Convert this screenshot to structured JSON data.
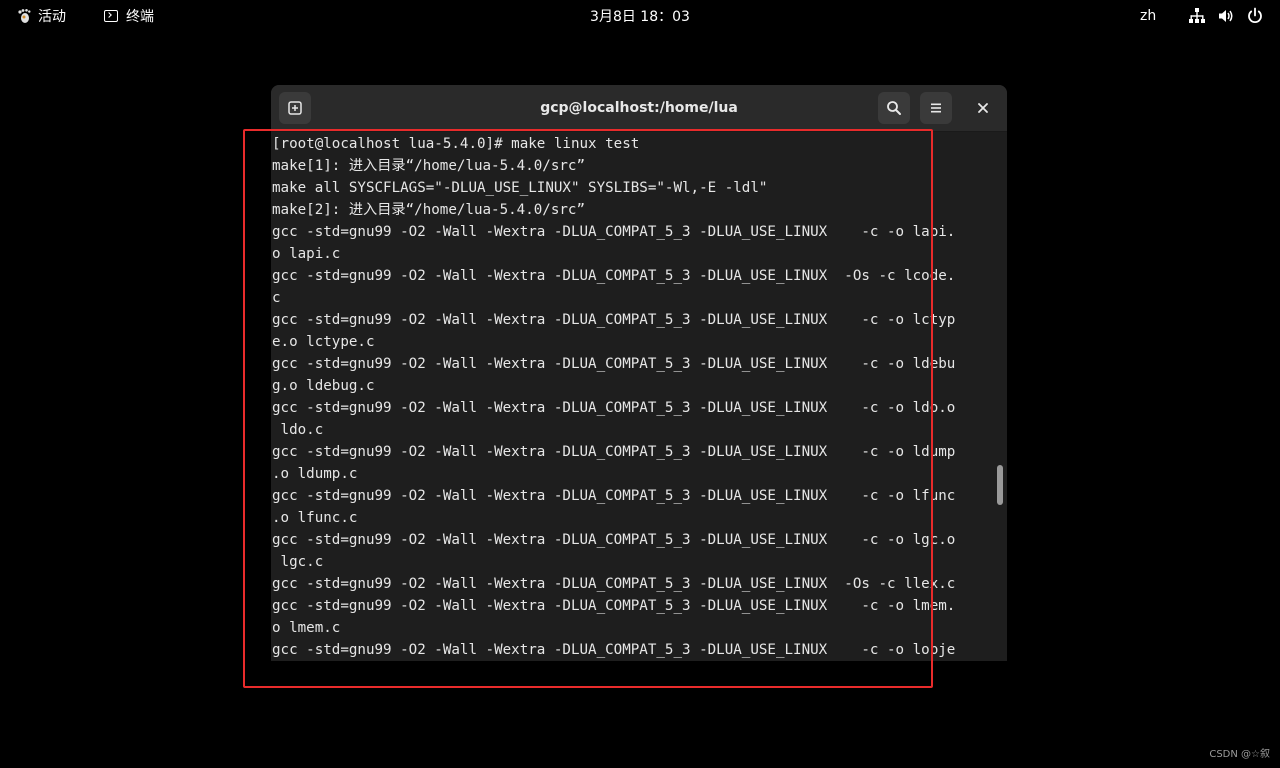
{
  "topbar": {
    "activities_label": "活动",
    "app_label": "终端",
    "clock": "3月8日 18：03",
    "language": "zh"
  },
  "icons": {
    "activities": "gnome-foot-icon",
    "app": "terminal-icon",
    "network": "network-icon",
    "volume": "volume-icon",
    "power": "power-icon",
    "new_tab": "new-tab-icon",
    "search": "search-icon",
    "menu": "hamburger-menu-icon",
    "close": "close-icon"
  },
  "window": {
    "title": "gcp@localhost:/home/lua"
  },
  "terminal": {
    "lines": [
      "[root@localhost lua-5.4.0]# make linux test",
      "make[1]: 进入目录“/home/lua-5.4.0/src”",
      "make all SYSCFLAGS=\"-DLUA_USE_LINUX\" SYSLIBS=\"-Wl,-E -ldl\"",
      "make[2]: 进入目录“/home/lua-5.4.0/src”",
      "gcc -std=gnu99 -O2 -Wall -Wextra -DLUA_COMPAT_5_3 -DLUA_USE_LINUX    -c -o lapi.",
      "o lapi.c",
      "gcc -std=gnu99 -O2 -Wall -Wextra -DLUA_COMPAT_5_3 -DLUA_USE_LINUX  -Os -c lcode.",
      "c",
      "gcc -std=gnu99 -O2 -Wall -Wextra -DLUA_COMPAT_5_3 -DLUA_USE_LINUX    -c -o lctyp",
      "e.o lctype.c",
      "gcc -std=gnu99 -O2 -Wall -Wextra -DLUA_COMPAT_5_3 -DLUA_USE_LINUX    -c -o ldebu",
      "g.o ldebug.c",
      "gcc -std=gnu99 -O2 -Wall -Wextra -DLUA_COMPAT_5_3 -DLUA_USE_LINUX    -c -o ldo.o",
      " ldo.c",
      "gcc -std=gnu99 -O2 -Wall -Wextra -DLUA_COMPAT_5_3 -DLUA_USE_LINUX    -c -o ldump",
      ".o ldump.c",
      "gcc -std=gnu99 -O2 -Wall -Wextra -DLUA_COMPAT_5_3 -DLUA_USE_LINUX    -c -o lfunc",
      ".o lfunc.c",
      "gcc -std=gnu99 -O2 -Wall -Wextra -DLUA_COMPAT_5_3 -DLUA_USE_LINUX    -c -o lgc.o",
      " lgc.c",
      "gcc -std=gnu99 -O2 -Wall -Wextra -DLUA_COMPAT_5_3 -DLUA_USE_LINUX  -Os -c llex.c",
      "gcc -std=gnu99 -O2 -Wall -Wextra -DLUA_COMPAT_5_3 -DLUA_USE_LINUX    -c -o lmem.",
      "o lmem.c",
      "gcc -std=gnu99 -O2 -Wall -Wextra -DLUA_COMPAT_5_3 -DLUA_USE_LINUX    -c -o lobje"
    ],
    "scroll_position": 0.68
  },
  "watermark": "CSDN @☆叙",
  "colors": {
    "highlight": "#e82b2b",
    "terminal_bg": "#1e1e1e",
    "headerbar_bg": "#2a2a2a"
  }
}
